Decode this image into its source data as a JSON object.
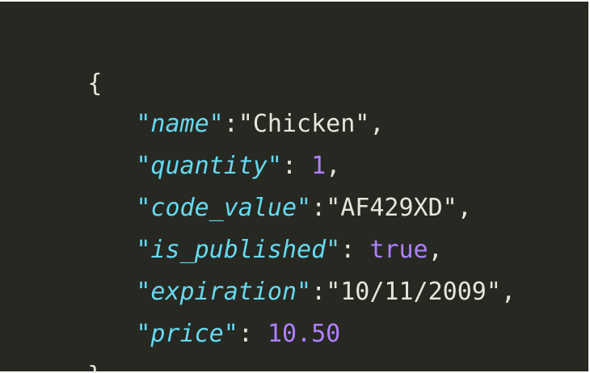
{
  "code": {
    "open_brace": "{",
    "close_brace": "}",
    "lines": [
      {
        "key": "\"name\"",
        "sep": ":",
        "value": "\"Chicken\"",
        "value_type": "string",
        "trail": ","
      },
      {
        "key": "\"quantity\"",
        "sep": ": ",
        "value": "1",
        "value_type": "number",
        "trail": ","
      },
      {
        "key": "\"code_value\"",
        "sep": ":",
        "value": "\"AF429XD\"",
        "value_type": "string",
        "trail": ","
      },
      {
        "key": "\"is_published\"",
        "sep": ": ",
        "value": "true",
        "value_type": "keyword",
        "trail": ","
      },
      {
        "key": "\"expiration\"",
        "sep": ":",
        "value": "\"10/11/2009\"",
        "value_type": "string",
        "trail": ","
      },
      {
        "key": "\"price\"",
        "sep": ": ",
        "value": "10.50",
        "value_type": "number",
        "trail": ""
      }
    ]
  },
  "colors": {
    "background": "#272822",
    "key": "#66d9ef",
    "string": "#e6e6dc",
    "number": "#ae81ff",
    "punctuation": "#e6e6dc"
  }
}
